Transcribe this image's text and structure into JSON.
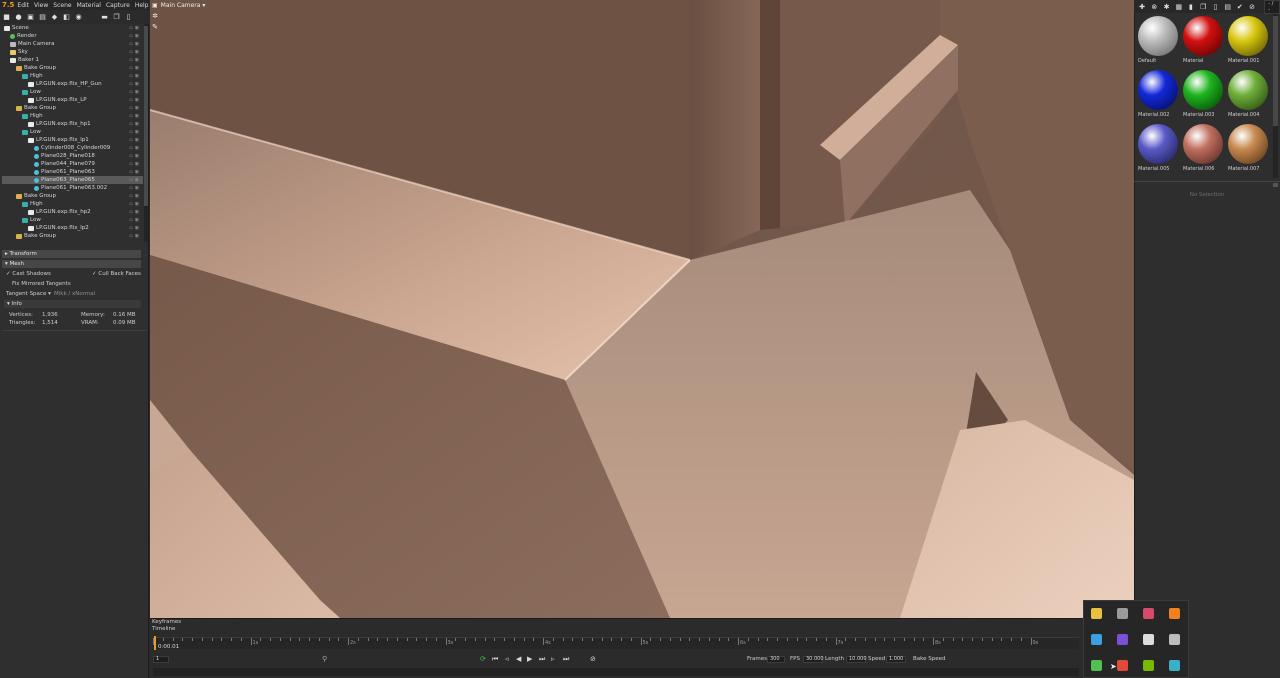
{
  "menubar": {
    "logo": "7.5",
    "items": [
      "Edit",
      "View",
      "Scene",
      "Material",
      "Capture",
      "Help"
    ]
  },
  "viewport": {
    "camera_label": "Main Camera ▾",
    "surface_color": "#d5a98e"
  },
  "scene_tree": [
    {
      "label": "Scene",
      "type": "obj",
      "depth": 0
    },
    {
      "label": "Render",
      "type": "render",
      "depth": 1
    },
    {
      "label": "Main Camera",
      "type": "cam",
      "depth": 1
    },
    {
      "label": "Sky",
      "type": "sky",
      "depth": 1
    },
    {
      "label": "Baker 1",
      "type": "obj",
      "depth": 1
    },
    {
      "label": "Bake Group",
      "type": "folder",
      "depth": 2
    },
    {
      "label": "High",
      "type": "grp",
      "depth": 3
    },
    {
      "label": "LP.GUN.exp.flix_HP_Gun",
      "type": "obj",
      "depth": 4
    },
    {
      "label": "Low",
      "type": "grp",
      "depth": 3
    },
    {
      "label": "LP.GUN.exp.flix_LP",
      "type": "obj",
      "depth": 4
    },
    {
      "label": "Bake Group",
      "type": "folder",
      "depth": 2
    },
    {
      "label": "High",
      "type": "grp",
      "depth": 3
    },
    {
      "label": "LP.GUN.exp.flix_hp1",
      "type": "obj",
      "depth": 4
    },
    {
      "label": "Low",
      "type": "grp",
      "depth": 3
    },
    {
      "label": "LP.GUN.exp.flix_lp1",
      "type": "obj",
      "depth": 4
    },
    {
      "label": "Cylinder008_Cylinder009",
      "type": "mesh",
      "depth": 5
    },
    {
      "label": "Plane028_Plane018",
      "type": "mesh",
      "depth": 5
    },
    {
      "label": "Plane044_Plane079",
      "type": "mesh",
      "depth": 5
    },
    {
      "label": "Plane061_Plane063",
      "type": "mesh",
      "depth": 5
    },
    {
      "label": "Plane063_Plane065",
      "type": "mesh",
      "depth": 5,
      "selected": true
    },
    {
      "label": "Plane061_Plane063.002",
      "type": "mesh",
      "depth": 5
    },
    {
      "label": "Bake Group",
      "type": "folder",
      "depth": 2
    },
    {
      "label": "High",
      "type": "grp",
      "depth": 3
    },
    {
      "label": "LP.GUN.exp.flix_hp2",
      "type": "obj",
      "depth": 4
    },
    {
      "label": "Low",
      "type": "grp",
      "depth": 3
    },
    {
      "label": "LP.GUN.exp.flix_lp2",
      "type": "obj",
      "depth": 4
    },
    {
      "label": "Bake Group",
      "type": "folder",
      "depth": 2
    }
  ],
  "properties": {
    "transform_header": "Transform",
    "mesh_header": "Mesh",
    "cast_shadows": "✓ Cast Shadows",
    "cull_back_faces": "✓ Cull Back Faces",
    "fix_mirrored": "Fix Mirrored Tangents",
    "tangent_space_label": "Tangent Space ▾",
    "tangent_space_value": "Mikk / xNormal",
    "info_header": "Info",
    "vertices_label": "Vertices:",
    "vertices_value": "1,936",
    "triangles_label": "Triangles:",
    "triangles_value": "1,514",
    "memory_label": "Memory:",
    "memory_value": "0.16 MB",
    "vram_label": "VRAM:",
    "vram_value": "0.09 MB"
  },
  "timeline": {
    "keyframes_label": "Keyframes",
    "timeline_label": "Timeline",
    "current_time": "0:00.01",
    "frame_field": "1",
    "tick_labels": [
      "1s",
      "2s",
      "3s",
      "4s",
      "5s",
      "6s",
      "7s",
      "8s",
      "9s"
    ],
    "frames_label": "Frames",
    "frames_value": "300",
    "fps_label": "FPS",
    "fps_value": "30.000",
    "length_label": "Length",
    "length_value": "10.000",
    "speed_label": "Speed",
    "speed_value": "1.000",
    "bake_speed_label": "Bake Speed"
  },
  "materials": [
    {
      "name": "Default",
      "color": "#bdbdbd",
      "shade": "#5a5a5a"
    },
    {
      "name": "Material",
      "color": "#d21010",
      "shade": "#4a0000"
    },
    {
      "name": "Material.001",
      "color": "#d8c810",
      "shade": "#4a4000"
    },
    {
      "name": "Material.002",
      "color": "#1428d8",
      "shade": "#000a4a"
    },
    {
      "name": "Material.003",
      "color": "#1fb41f",
      "shade": "#003a00"
    },
    {
      "name": "Material.004",
      "color": "#6fb03a",
      "shade": "#1f3a08"
    },
    {
      "name": "Material.005",
      "color": "#5a5ac8",
      "shade": "#181848"
    },
    {
      "name": "Material.006",
      "color": "#c07060",
      "shade": "#4a2018"
    },
    {
      "name": "Material.007",
      "color": "#c88a50",
      "shade": "#4a2a10"
    }
  ],
  "right_panel": {
    "no_selection": "No Selection",
    "zoom_field": "- / -"
  },
  "tray_icons": [
    {
      "name": "shield-icon",
      "color": "#e8c040"
    },
    {
      "name": "cloud-off-icon",
      "color": "#9a9a9a"
    },
    {
      "name": "color-picker-icon",
      "color": "#d84a6a"
    },
    {
      "name": "tool-icon",
      "color": "#f08020"
    },
    {
      "name": "telegram-icon",
      "color": "#3aa0e0"
    },
    {
      "name": "display-icon",
      "color": "#7a50d8"
    },
    {
      "name": "cursor-icon",
      "color": "#dcdcdc"
    },
    {
      "name": "pen-icon",
      "color": "#bcbcbc"
    },
    {
      "name": "sync-icon",
      "color": "#50c050"
    },
    {
      "name": "chrome-icon",
      "color": "#e04a3a"
    },
    {
      "name": "nvidia-icon",
      "color": "#76b900"
    },
    {
      "name": "app-icon",
      "color": "#3ab0c8"
    }
  ]
}
